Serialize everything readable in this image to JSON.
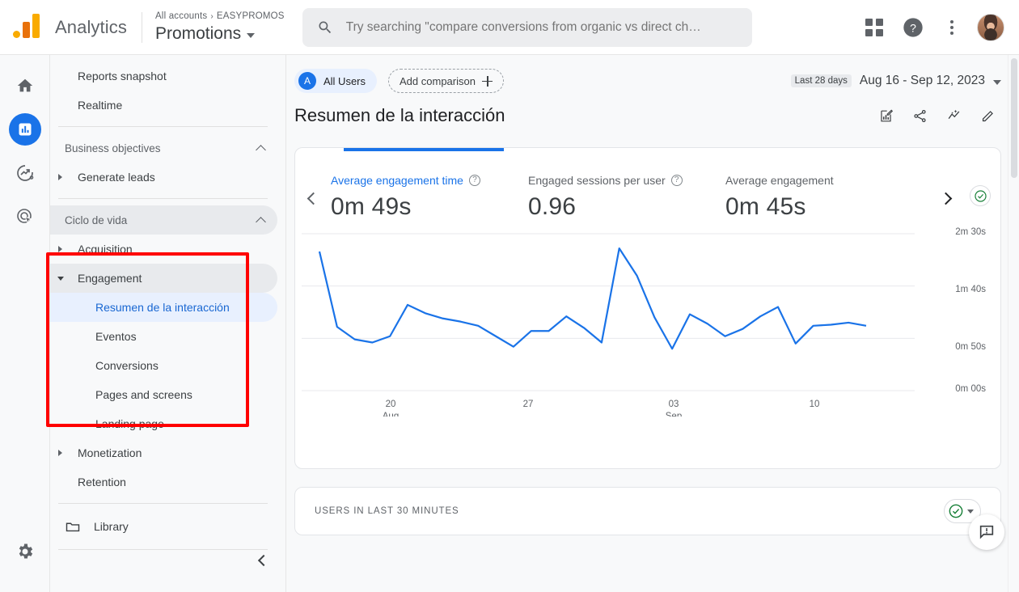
{
  "topbar": {
    "brand": "Analytics",
    "breadcrumb_all": "All accounts",
    "breadcrumb_sep": "›",
    "breadcrumb_account": "EASYPROMOS",
    "property_name": "Promotions",
    "search_placeholder": "Try searching \"compare conversions from organic vs direct ch…",
    "icons": {
      "apps": "apps-grid-icon",
      "help": "help-icon",
      "more": "more-vert-icon",
      "avatar": "user-avatar"
    }
  },
  "rail": {
    "items": [
      {
        "name": "home",
        "label": "Home",
        "active": false
      },
      {
        "name": "reports",
        "label": "Reports",
        "active": true
      },
      {
        "name": "explore",
        "label": "Explore",
        "active": false
      },
      {
        "name": "advertising",
        "label": "Advertising",
        "active": false
      }
    ],
    "settings_label": "Admin"
  },
  "sidebar": {
    "items": [
      {
        "label": "Reports snapshot",
        "type": "item"
      },
      {
        "label": "Realtime",
        "type": "item"
      },
      {
        "label": "Business objectives",
        "type": "header",
        "expanded": true
      },
      {
        "label": "Generate leads",
        "type": "collapsed-parent"
      },
      {
        "label": "Ciclo de vida",
        "type": "header",
        "expanded": true,
        "hovered": true
      },
      {
        "label": "Acquisition",
        "type": "collapsed-parent"
      },
      {
        "label": "Engagement",
        "type": "expanded-parent",
        "hovered": true
      },
      {
        "label": "Resumen de la interacción",
        "type": "sub",
        "selected": true
      },
      {
        "label": "Eventos",
        "type": "sub"
      },
      {
        "label": "Conversions",
        "type": "sub"
      },
      {
        "label": "Pages and screens",
        "type": "sub"
      },
      {
        "label": "Landing page",
        "type": "sub"
      },
      {
        "label": "Monetization",
        "type": "collapsed-parent"
      },
      {
        "label": "Retention",
        "type": "item"
      }
    ],
    "library_label": "Library",
    "collapse_label": "Collapse navigation"
  },
  "main": {
    "audience_chip": {
      "initial": "A",
      "label": "All Users"
    },
    "add_comparison_label": "Add comparison",
    "date": {
      "preset": "Last 28 days",
      "range": "Aug 16 - Sep 12, 2023"
    },
    "page_title": "Resumen de la interacción",
    "title_icons": [
      {
        "name": "customize-report-icon",
        "label": "Customize report"
      },
      {
        "name": "share-icon",
        "label": "Share this report"
      },
      {
        "name": "insights-icon",
        "label": "Insights"
      },
      {
        "name": "edit-icon",
        "label": "Edit"
      }
    ],
    "metrics": [
      {
        "name": "average-engagement-time",
        "label": "Average engagement time",
        "value": "0m 49s",
        "has_help": true,
        "active": true
      },
      {
        "name": "engaged-sessions-per-user",
        "label": "Engaged sessions per user",
        "value": "0.96",
        "has_help": true,
        "active": false
      },
      {
        "name": "average-engagement",
        "label": "Average engagement",
        "value": "0m 45s",
        "has_help": false,
        "active": false
      }
    ],
    "data_quality_label": "Data quality OK",
    "realtime": {
      "label": "USERS IN LAST 30 MINUTES"
    },
    "feedback_label": "Send feedback"
  },
  "colors": {
    "brand_blue": "#1a73e8",
    "line_blue": "#1a73e8",
    "annotation_red": "#ff0000",
    "green_check": "#188038",
    "logo_orange": "#e8710a",
    "logo_yellow": "#f9ab00"
  },
  "chart_data": {
    "type": "line",
    "title": "Average engagement time",
    "xlabel": "",
    "ylabel": "",
    "ylim": [
      0,
      150
    ],
    "ytick_labels": [
      "2m 30s",
      "1m 40s",
      "0m 50s",
      "0m 00s"
    ],
    "ytick_values": [
      150,
      100,
      50,
      0
    ],
    "xtick_labels": [
      {
        "day": "20",
        "month": "Aug"
      },
      {
        "day": "27",
        "month": ""
      },
      {
        "day": "03",
        "month": "Sep"
      },
      {
        "day": "10",
        "month": ""
      }
    ],
    "grid": true,
    "legend": "none",
    "series": [
      {
        "name": "Average engagement time",
        "color": "#1a73e8",
        "values": [
          133,
          61,
          49,
          46,
          52,
          82,
          74,
          69,
          66,
          62,
          52,
          42,
          57,
          57,
          71,
          60,
          46,
          136,
          110,
          70,
          40,
          73,
          64,
          52,
          59,
          71,
          80,
          45,
          62,
          63,
          65,
          62
        ]
      }
    ]
  }
}
